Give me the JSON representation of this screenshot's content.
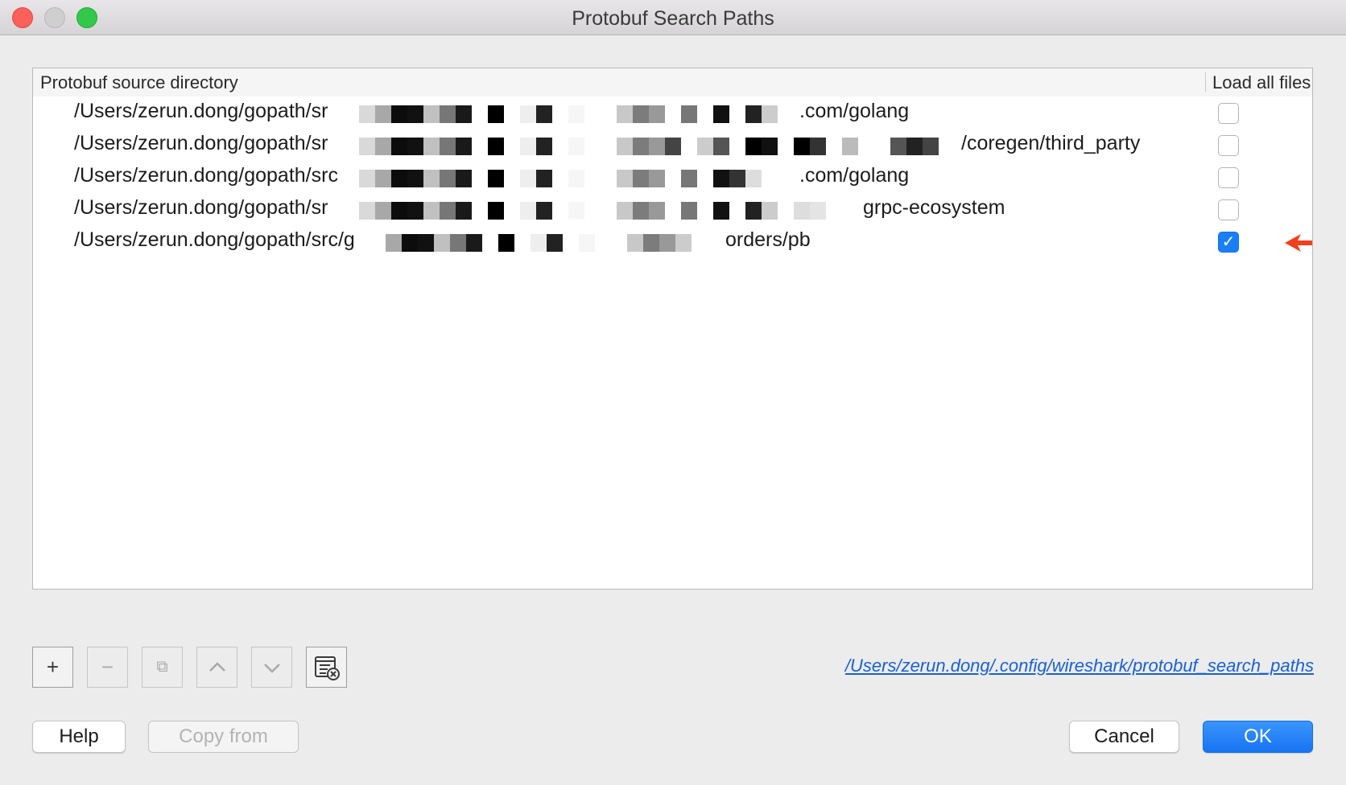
{
  "window": {
    "title": "Protobuf Search Paths"
  },
  "table": {
    "columns": [
      "Protobuf source directory",
      "Load all files"
    ],
    "rows": [
      {
        "path_prefix": "/Users/zerun.dong/gopath/sr",
        "path_suffix": ".com/golang",
        "load_all": false
      },
      {
        "path_prefix": "/Users/zerun.dong/gopath/sr",
        "path_suffix": "/coregen/third_party",
        "load_all": false
      },
      {
        "path_prefix": "/Users/zerun.dong/gopath/src",
        "path_suffix": ".com/golang",
        "load_all": false
      },
      {
        "path_prefix": "/Users/zerun.dong/gopath/sr",
        "path_suffix": "grpc-ecosystem",
        "load_all": false
      },
      {
        "path_prefix": "/Users/zerun.dong/gopath/src/g",
        "path_suffix": "orders/pb",
        "load_all": true
      }
    ]
  },
  "toolbar": {
    "buttons": [
      {
        "name": "add",
        "icon": "plus-icon",
        "glyph": "+",
        "enabled": true
      },
      {
        "name": "remove",
        "icon": "minus-icon",
        "glyph": "−",
        "enabled": false
      },
      {
        "name": "copy",
        "icon": "copy-icon",
        "glyph": "⧉",
        "enabled": false
      },
      {
        "name": "move-up",
        "icon": "chevron-up-icon",
        "glyph": "︿",
        "enabled": false
      },
      {
        "name": "move-down",
        "icon": "chevron-down-icon",
        "glyph": "﹀",
        "enabled": false
      },
      {
        "name": "clear",
        "icon": "clear-list-icon",
        "glyph": "",
        "enabled": true
      }
    ]
  },
  "config_path": "/Users/zerun.dong/.config/wireshark/protobuf_search_paths",
  "buttons": {
    "help": "Help",
    "copy_from": "Copy from",
    "cancel": "Cancel",
    "ok": "OK"
  },
  "colors": {
    "accent": "#1a7ff5",
    "annotation_arrow": "#f0401c",
    "link": "#1860d6"
  },
  "check_glyph": "✓"
}
